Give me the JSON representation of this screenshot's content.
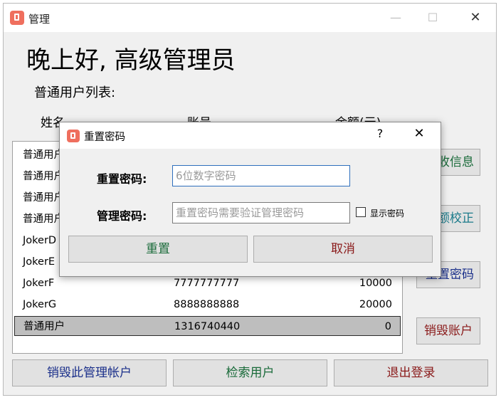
{
  "window": {
    "title": "管理"
  },
  "greeting": "晚上好, 高级管理员",
  "list_caption": "普通用户列表:",
  "columns": {
    "name": "姓名",
    "account": "账号",
    "balance": "余额(元)"
  },
  "rows": [
    {
      "name": "普通用户",
      "account": "",
      "balance": ""
    },
    {
      "name": "普通用户",
      "account": "",
      "balance": ""
    },
    {
      "name": "普通用户",
      "account": "",
      "balance": ""
    },
    {
      "name": "普通用户",
      "account": "",
      "balance": ""
    },
    {
      "name": "JokerD",
      "account": "",
      "balance": ""
    },
    {
      "name": "JokerE",
      "account": "",
      "balance": ""
    },
    {
      "name": "JokerF",
      "account": "7777777777",
      "balance": "10000"
    },
    {
      "name": "JokerG",
      "account": "8888888888",
      "balance": "20000"
    },
    {
      "name": "普通用户",
      "account": "1316740440",
      "balance": "0",
      "selected": true
    }
  ],
  "side_buttons": {
    "edit": "收信息",
    "balance": "额校正",
    "reset_password": "重置密码",
    "destroy": "销毁账户"
  },
  "bottom_buttons": {
    "destroy_admin": "销毁此管理帐户",
    "search": "检索用户",
    "logout": "退出登录"
  },
  "dialog": {
    "title": "重置密码",
    "help": "?",
    "reset_label": "重置密码:",
    "reset_placeholder": "6位数字密码",
    "admin_label": "管理密码:",
    "admin_placeholder": "重置密码需要验证管理密码",
    "show_password": "显示密码",
    "reset_button": "重置",
    "cancel_button": "取消"
  }
}
